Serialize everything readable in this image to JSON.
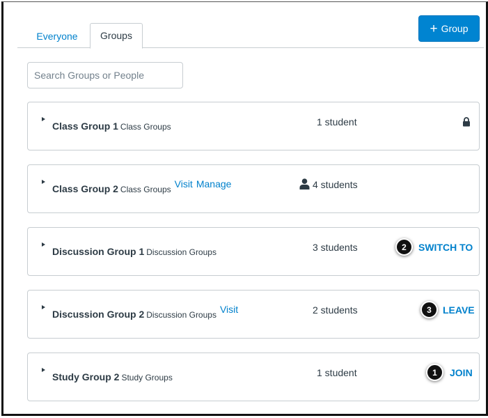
{
  "tabs": [
    {
      "label": "Everyone"
    },
    {
      "label": "Groups"
    }
  ],
  "add_group": {
    "label": "Group",
    "icon": "plus-icon"
  },
  "search": {
    "placeholder": "Search Groups or People"
  },
  "colors": {
    "accent": "#0081cc",
    "button": "#0084d1",
    "border": "#c7cdd1",
    "text": "#2d3b45"
  },
  "groups": [
    {
      "name": "Class Group 1",
      "category": "Class Groups",
      "links": [],
      "count": "1 student",
      "icon": "lock-icon",
      "action": "",
      "badge": ""
    },
    {
      "name": "Class Group 2",
      "category": "Class Groups",
      "links": [
        "Visit",
        "Manage"
      ],
      "count": "4 students",
      "icon": "person-icon",
      "action": "",
      "badge": ""
    },
    {
      "name": "Discussion Group 1",
      "category": "Discussion Groups",
      "links": [],
      "count": "3 students",
      "icon": "",
      "action": "SWITCH TO",
      "badge": "2"
    },
    {
      "name": "Discussion Group 2",
      "category": "Discussion Groups",
      "links": [
        "Visit"
      ],
      "count": "2 students",
      "icon": "",
      "action": "LEAVE",
      "badge": "3"
    },
    {
      "name": "Study Group 2",
      "category": "Study Groups",
      "links": [],
      "count": "1 student",
      "icon": "",
      "action": "JOIN",
      "badge": "1"
    }
  ]
}
